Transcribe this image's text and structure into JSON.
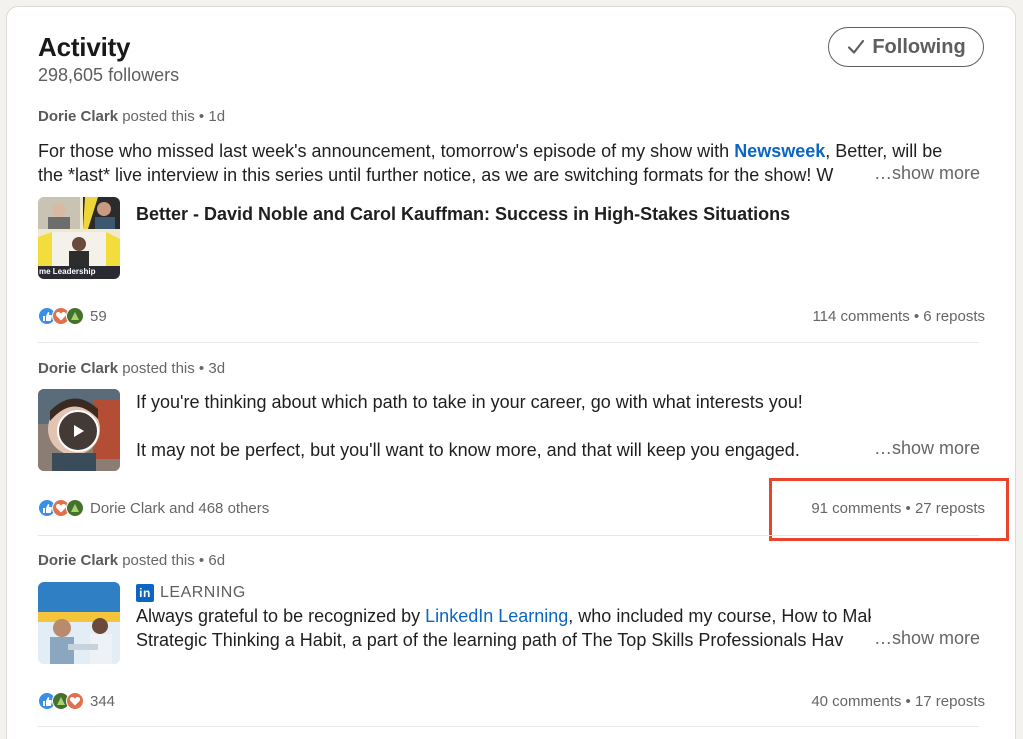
{
  "header": {
    "title": "Activity",
    "followers": "298,605 followers",
    "follow_button": "Following"
  },
  "posts": [
    {
      "author": "Dorie Clark",
      "meta": "posted this • 1d",
      "line1_pre": "For those who missed last week's announcement, tomorrow's episode of my show with ",
      "line1_link": "Newsweek",
      "line1_post": ", Better, will be",
      "line2": "the *last* live interview in this series until further notice, as we are switching formats for the show! W",
      "show_more": "…show more",
      "article_title": "Better - David Noble and Carol Kauffman: Success in High-Stakes Situations",
      "thumb_caption": "me Leadership",
      "reaction_count": "59",
      "stats": "114 comments • 6 reposts"
    },
    {
      "author": "Dorie Clark",
      "meta": "posted this • 3d",
      "line1": "If you're thinking about which path to take in your career, go with what interests you!",
      "line2": "It may not be perfect, but you'll want to know more, and that will keep you engaged.",
      "show_more": "…show more",
      "reaction_count": "Dorie Clark and 468 others",
      "stats": "91 comments • 27 reposts"
    },
    {
      "author": "Dorie Clark",
      "meta": "posted this • 6d",
      "badge": "LEARNING",
      "badge_logo": "in",
      "line1_pre": "Always grateful to be recognized by ",
      "line1_link": "LinkedIn Learning",
      "line1_post": ", who included my course, How to Make",
      "line2": "Strategic Thinking a Habit, a part of the learning path of The Top Skills Professionals Hav",
      "show_more": "…show more",
      "reaction_count": "344",
      "stats": "40 comments • 17 reposts"
    }
  ],
  "icons": {
    "follow": "check-icon",
    "reactions": [
      "like-icon",
      "love-icon",
      "support-icon"
    ],
    "video": "play-icon"
  },
  "colors": {
    "link": "#0a66c2",
    "highlight": "#e8452c",
    "like": "#378fe9",
    "love": "#df704d",
    "support": "#44712e"
  }
}
